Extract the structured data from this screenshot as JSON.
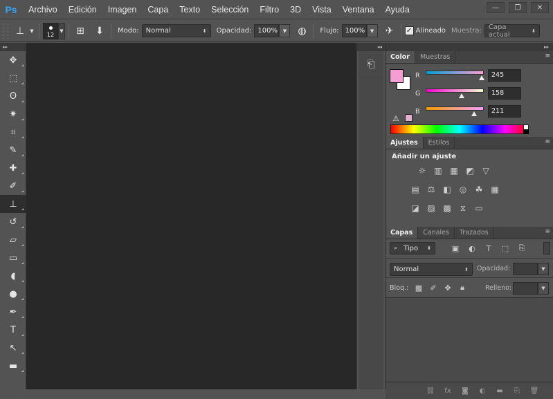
{
  "app": {
    "logo": "Ps",
    "accent": "#31a8ff"
  },
  "menu": [
    "Archivo",
    "Edición",
    "Imagen",
    "Capa",
    "Texto",
    "Selección",
    "Filtro",
    "3D",
    "Vista",
    "Ventana",
    "Ayuda"
  ],
  "window_controls": {
    "minimize": "—",
    "restore": "❐",
    "close": "✕"
  },
  "options": {
    "brush_size": "12",
    "mode_label": "Modo:",
    "mode_value": "Normal",
    "opacity_label": "Opacidad:",
    "opacity_value": "100%",
    "flow_label": "Flujo:",
    "flow_value": "100%",
    "aligned_label": "Alineado",
    "aligned_checked": "✓",
    "sample_label": "Muestra:",
    "sample_value": "Capa actual"
  },
  "tools": [
    {
      "name": "move-tool",
      "glyph": "✥"
    },
    {
      "name": "marquee-tool",
      "glyph": "⬚"
    },
    {
      "name": "lasso-tool",
      "glyph": "ʘ"
    },
    {
      "name": "magic-wand-tool",
      "glyph": "✷"
    },
    {
      "name": "crop-tool",
      "glyph": "⌗"
    },
    {
      "name": "eyedropper-tool",
      "glyph": "✎"
    },
    {
      "name": "healing-brush-tool",
      "glyph": "✚"
    },
    {
      "name": "brush-tool",
      "glyph": "✐"
    },
    {
      "name": "clone-stamp-tool",
      "glyph": "⊥"
    },
    {
      "name": "history-brush-tool",
      "glyph": "↺"
    },
    {
      "name": "eraser-tool",
      "glyph": "▱"
    },
    {
      "name": "gradient-tool",
      "glyph": "▭"
    },
    {
      "name": "blur-tool",
      "glyph": "◖"
    },
    {
      "name": "dodge-tool",
      "glyph": "●"
    },
    {
      "name": "pen-tool",
      "glyph": "✒"
    },
    {
      "name": "type-tool",
      "glyph": "T"
    },
    {
      "name": "path-selection-tool",
      "glyph": "↖"
    },
    {
      "name": "rectangle-tool",
      "glyph": "▬"
    }
  ],
  "color_panel": {
    "tabs": [
      "Color",
      "Muestras"
    ],
    "r_label": "R",
    "r_value": "245",
    "g_label": "G",
    "g_value": "158",
    "b_label": "B",
    "b_value": "211",
    "r_level": 0.96,
    "g_level": 0.62,
    "b_level": 0.83,
    "foreground_color": "#f59ed3",
    "background_color": "#ffffff"
  },
  "adjustments_panel": {
    "tabs": [
      "Ajustes",
      "Estilos"
    ],
    "title": "Añadir un ajuste"
  },
  "layers_panel": {
    "tabs": [
      "Capas",
      "Canales",
      "Trazados"
    ],
    "filter_value": "Tipo",
    "blend_value": "Normal",
    "opacity_label": "Opacidad:",
    "lock_label": "Bloq.:",
    "fill_label": "Relleno:"
  }
}
